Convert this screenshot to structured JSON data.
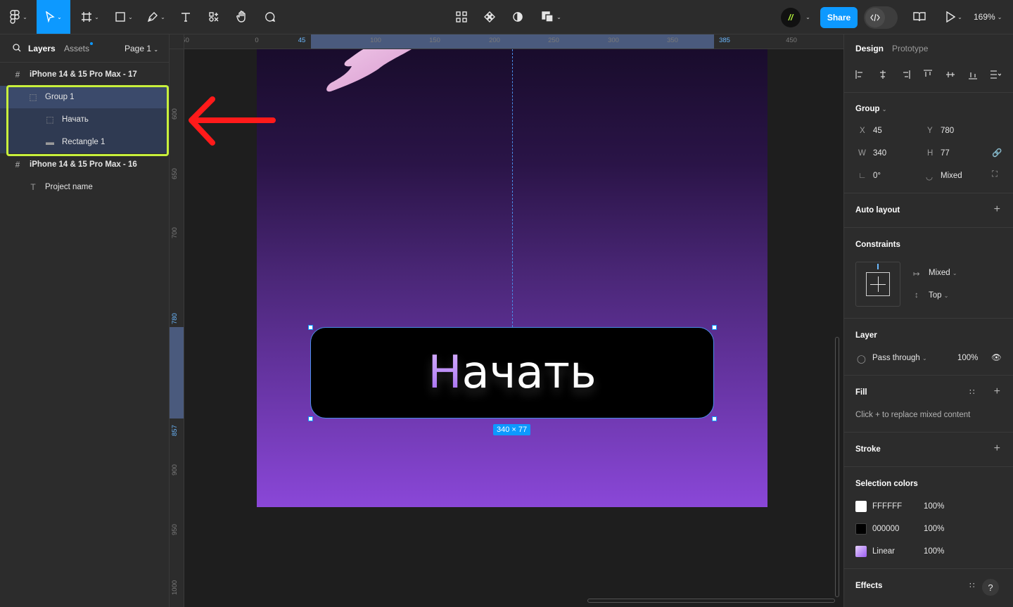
{
  "toolbar": {
    "share_label": "Share",
    "zoom": "169%",
    "avatar_initial": "//"
  },
  "left_panel": {
    "tabs": {
      "layers": "Layers",
      "assets": "Assets",
      "page": "Page 1"
    },
    "layers": [
      {
        "label": "iPhone 14 & 15 Pro Max - 17",
        "icon": "frame-icon",
        "indent": 0
      },
      {
        "label": "Group 1",
        "icon": "group-icon",
        "indent": 1
      },
      {
        "label": "Начать",
        "icon": "group-icon",
        "indent": 2
      },
      {
        "label": "Rectangle 1",
        "icon": "rectangle-icon",
        "indent": 2
      },
      {
        "label": "iPhone 14 & 15 Pro Max - 16",
        "icon": "frame-icon",
        "indent": 0
      },
      {
        "label": "Project name",
        "icon": "text-icon",
        "indent": 1
      }
    ]
  },
  "canvas": {
    "ruler_top": [
      "-50",
      "0",
      "45",
      "100",
      "150",
      "200",
      "250",
      "300",
      "350",
      "385",
      "450"
    ],
    "ruler_left": [
      "600",
      "650",
      "700",
      "780",
      "857",
      "900",
      "950",
      "1000"
    ],
    "button_text": "Начать",
    "button_first_letter": "Н",
    "button_rest": "ачать",
    "size_badge": "340 × 77"
  },
  "right_panel": {
    "tabs": {
      "design": "Design",
      "prototype": "Prototype"
    },
    "group": {
      "title": "Group",
      "x_label": "X",
      "x": "45",
      "y_label": "Y",
      "y": "780",
      "w_label": "W",
      "w": "340",
      "h_label": "H",
      "h": "77",
      "rotation": "0°",
      "radius": "Mixed"
    },
    "auto_layout": "Auto layout",
    "constraints": {
      "title": "Constraints",
      "horizontal": "Mixed",
      "vertical": "Top"
    },
    "layer": {
      "title": "Layer",
      "blend": "Pass through",
      "opacity": "100%"
    },
    "fill": {
      "title": "Fill",
      "hint": "Click + to replace mixed content"
    },
    "stroke": "Stroke",
    "selection_colors": {
      "title": "Selection colors",
      "items": [
        {
          "name": "FFFFFF",
          "opacity": "100%",
          "color": "#FFFFFF"
        },
        {
          "name": "000000",
          "opacity": "100%",
          "color": "#000000"
        },
        {
          "name": "Linear",
          "opacity": "100%",
          "color": "#c9a8f5"
        }
      ]
    },
    "effects": "Effects",
    "help": "?"
  },
  "colors": {
    "accent": "#0d99ff",
    "highlight": "#c8f03c",
    "arrow": "#ff1a1a"
  }
}
